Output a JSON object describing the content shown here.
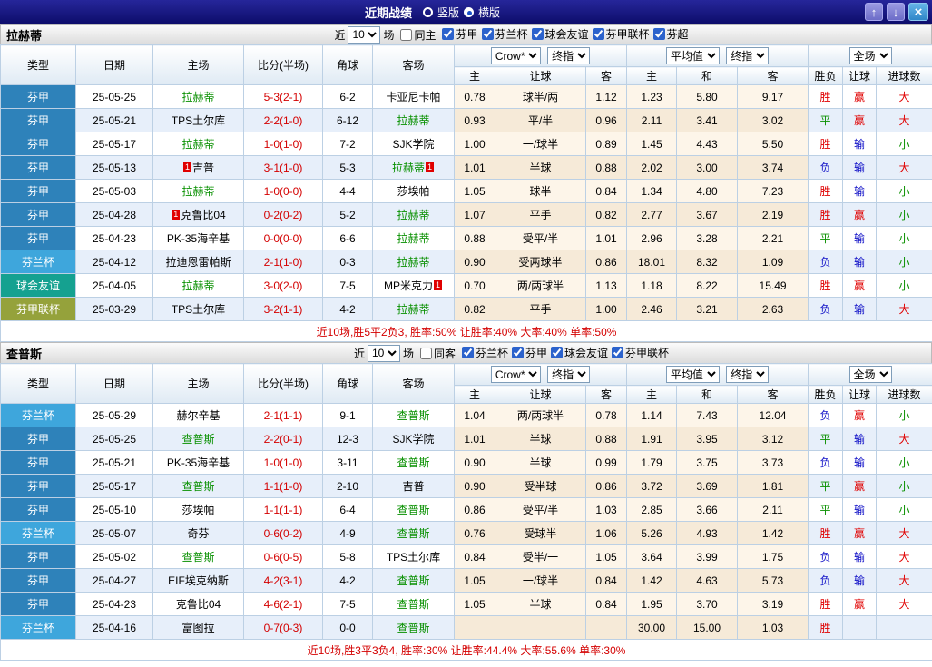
{
  "titlebar": {
    "title": "近期战绩",
    "vertical_label": "竖版",
    "horizontal_label": "横版",
    "selected": "横版",
    "up_icon": "↑",
    "down_icon": "↓",
    "close_icon": "×"
  },
  "type_colors": {
    "芬甲": "#2e82ba",
    "芬兰杯": "#3ea6dc",
    "球会友谊": "#15a190",
    "芬甲联杯": "#95a23b"
  },
  "value_colors": {
    "胜": "#e00000",
    "负": "#1515c8",
    "平": "#0a9000",
    "赢": "#e00000",
    "输": "#1515c8",
    "大": "#e00000",
    "小": "#0a9000"
  },
  "table_header": {
    "type": "类型",
    "date": "日期",
    "home": "主场",
    "score": "比分(半场)",
    "corner": "角球",
    "away": "客场",
    "odds_source": "Crow*",
    "odds_period": "终指",
    "avg_source": "平均值",
    "avg_period": "终指",
    "scope": "全场",
    "h": "主",
    "handicap": "让球",
    "a": "客",
    "avg_h": "主",
    "avg_d": "和",
    "avg_a": "客",
    "result": "胜负",
    "handicap_result": "让球",
    "goals": "进球数"
  },
  "sections": [
    {
      "team": "拉赫蒂",
      "filters": {
        "recent_label": "近",
        "recent_value": "10",
        "games_label": "场",
        "same_label": "同主",
        "same_checked": false,
        "leagues": [
          {
            "label": "芬甲",
            "checked": true
          },
          {
            "label": "芬兰杯",
            "checked": true
          },
          {
            "label": "球会友谊",
            "checked": true
          },
          {
            "label": "芬甲联杯",
            "checked": true
          },
          {
            "label": "芬超",
            "checked": true
          }
        ]
      },
      "rows": [
        {
          "type": "芬甲",
          "date": "25-05-25",
          "home": "拉赫蒂",
          "home_card": "",
          "home_focus": true,
          "score": "5-3(2-1)",
          "corners": "6-2",
          "away": "卡亚尼卡帕",
          "away_card": "",
          "away_focus": false,
          "odds_home": "0.78",
          "handicap": "球半/两",
          "odds_away": "1.12",
          "avg_home": "1.23",
          "avg_draw": "5.80",
          "avg_away": "9.17",
          "result": "胜",
          "handicap_result": "赢",
          "goals": "大"
        },
        {
          "type": "芬甲",
          "date": "25-05-21",
          "home": "TPS土尔库",
          "home_card": "",
          "home_focus": false,
          "score": "2-2(1-0)",
          "corners": "6-12",
          "away": "拉赫蒂",
          "away_card": "",
          "away_focus": true,
          "odds_home": "0.93",
          "handicap": "平/半",
          "odds_away": "0.96",
          "avg_home": "2.11",
          "avg_draw": "3.41",
          "avg_away": "3.02",
          "result": "平",
          "handicap_result": "赢",
          "goals": "大"
        },
        {
          "type": "芬甲",
          "date": "25-05-17",
          "home": "拉赫蒂",
          "home_card": "",
          "home_focus": true,
          "score": "1-0(1-0)",
          "corners": "7-2",
          "away": "SJK学院",
          "away_card": "",
          "away_focus": false,
          "odds_home": "1.00",
          "handicap": "一/球半",
          "odds_away": "0.89",
          "avg_home": "1.45",
          "avg_draw": "4.43",
          "avg_away": "5.50",
          "result": "胜",
          "handicap_result": "输",
          "goals": "小"
        },
        {
          "type": "芬甲",
          "date": "25-05-13",
          "home": "吉普",
          "home_card": "1",
          "home_focus": false,
          "score": "3-1(1-0)",
          "corners": "5-3",
          "away": "拉赫蒂",
          "away_card": "1",
          "away_focus": true,
          "odds_home": "1.01",
          "handicap": "半球",
          "odds_away": "0.88",
          "avg_home": "2.02",
          "avg_draw": "3.00",
          "avg_away": "3.74",
          "result": "负",
          "handicap_result": "输",
          "goals": "大"
        },
        {
          "type": "芬甲",
          "date": "25-05-03",
          "home": "拉赫蒂",
          "home_card": "",
          "home_focus": true,
          "score": "1-0(0-0)",
          "corners": "4-4",
          "away": "莎埃帕",
          "away_card": "",
          "away_focus": false,
          "odds_home": "1.05",
          "handicap": "球半",
          "odds_away": "0.84",
          "avg_home": "1.34",
          "avg_draw": "4.80",
          "avg_away": "7.23",
          "result": "胜",
          "handicap_result": "输",
          "goals": "小"
        },
        {
          "type": "芬甲",
          "date": "25-04-28",
          "home": "克鲁比04",
          "home_card": "1",
          "home_focus": false,
          "score": "0-2(0-2)",
          "corners": "5-2",
          "away": "拉赫蒂",
          "away_card": "",
          "away_focus": true,
          "odds_home": "1.07",
          "handicap": "平手",
          "odds_away": "0.82",
          "avg_home": "2.77",
          "avg_draw": "3.67",
          "avg_away": "2.19",
          "result": "胜",
          "handicap_result": "赢",
          "goals": "小"
        },
        {
          "type": "芬甲",
          "date": "25-04-23",
          "home": "PK-35海辛基",
          "home_card": "",
          "home_focus": false,
          "score": "0-0(0-0)",
          "corners": "6-6",
          "away": "拉赫蒂",
          "away_card": "",
          "away_focus": true,
          "odds_home": "0.88",
          "handicap": "受平/半",
          "odds_away": "1.01",
          "avg_home": "2.96",
          "avg_draw": "3.28",
          "avg_away": "2.21",
          "result": "平",
          "handicap_result": "输",
          "goals": "小"
        },
        {
          "type": "芬兰杯",
          "date": "25-04-12",
          "home": "拉迪恩雷帕斯",
          "home_card": "",
          "home_focus": false,
          "score": "2-1(1-0)",
          "corners": "0-3",
          "away": "拉赫蒂",
          "away_card": "",
          "away_focus": true,
          "odds_home": "0.90",
          "handicap": "受两球半",
          "odds_away": "0.86",
          "avg_home": "18.01",
          "avg_draw": "8.32",
          "avg_away": "1.09",
          "result": "负",
          "handicap_result": "输",
          "goals": "小"
        },
        {
          "type": "球会友谊",
          "date": "25-04-05",
          "home": "拉赫蒂",
          "home_card": "",
          "home_focus": true,
          "score": "3-0(2-0)",
          "corners": "7-5",
          "away": "MP米克力",
          "away_card": "1",
          "away_focus": false,
          "odds_home": "0.70",
          "handicap": "两/两球半",
          "odds_away": "1.13",
          "avg_home": "1.18",
          "avg_draw": "8.22",
          "avg_away": "15.49",
          "result": "胜",
          "handicap_result": "赢",
          "goals": "小"
        },
        {
          "type": "芬甲联杯",
          "date": "25-03-29",
          "home": "TPS土尔库",
          "home_card": "",
          "home_focus": false,
          "score": "3-2(1-1)",
          "corners": "4-2",
          "away": "拉赫蒂",
          "away_card": "",
          "away_focus": true,
          "odds_home": "0.82",
          "handicap": "平手",
          "odds_away": "1.00",
          "avg_home": "2.46",
          "avg_draw": "3.21",
          "avg_away": "2.63",
          "result": "负",
          "handicap_result": "输",
          "goals": "大"
        }
      ],
      "summary": "近10场,胜5平2负3, 胜率:50% 让胜率:40% 大率:40% 单率:50%"
    },
    {
      "team": "查普斯",
      "filters": {
        "recent_label": "近",
        "recent_value": "10",
        "games_label": "场",
        "same_label": "同客",
        "same_checked": false,
        "leagues": [
          {
            "label": "芬兰杯",
            "checked": true
          },
          {
            "label": "芬甲",
            "checked": true
          },
          {
            "label": "球会友谊",
            "checked": true
          },
          {
            "label": "芬甲联杯",
            "checked": true
          }
        ]
      },
      "rows": [
        {
          "type": "芬兰杯",
          "date": "25-05-29",
          "home": "赫尔辛基",
          "home_card": "",
          "home_focus": false,
          "score": "2-1(1-1)",
          "corners": "9-1",
          "away": "查普斯",
          "away_card": "",
          "away_focus": true,
          "odds_home": "1.04",
          "handicap": "两/两球半",
          "odds_away": "0.78",
          "avg_home": "1.14",
          "avg_draw": "7.43",
          "avg_away": "12.04",
          "result": "负",
          "handicap_result": "赢",
          "goals": "小"
        },
        {
          "type": "芬甲",
          "date": "25-05-25",
          "home": "查普斯",
          "home_card": "",
          "home_focus": true,
          "score": "2-2(0-1)",
          "corners": "12-3",
          "away": "SJK学院",
          "away_card": "",
          "away_focus": false,
          "odds_home": "1.01",
          "handicap": "半球",
          "odds_away": "0.88",
          "avg_home": "1.91",
          "avg_draw": "3.95",
          "avg_away": "3.12",
          "result": "平",
          "handicap_result": "输",
          "goals": "大"
        },
        {
          "type": "芬甲",
          "date": "25-05-21",
          "home": "PK-35海辛基",
          "home_card": "",
          "home_focus": false,
          "score": "1-0(1-0)",
          "corners": "3-11",
          "away": "查普斯",
          "away_card": "",
          "away_focus": true,
          "odds_home": "0.90",
          "handicap": "半球",
          "odds_away": "0.99",
          "avg_home": "1.79",
          "avg_draw": "3.75",
          "avg_away": "3.73",
          "result": "负",
          "handicap_result": "输",
          "goals": "小"
        },
        {
          "type": "芬甲",
          "date": "25-05-17",
          "home": "查普斯",
          "home_card": "",
          "home_focus": true,
          "score": "1-1(1-0)",
          "corners": "2-10",
          "away": "吉普",
          "away_card": "",
          "away_focus": false,
          "odds_home": "0.90",
          "handicap": "受半球",
          "odds_away": "0.86",
          "avg_home": "3.72",
          "avg_draw": "3.69",
          "avg_away": "1.81",
          "result": "平",
          "handicap_result": "赢",
          "goals": "小"
        },
        {
          "type": "芬甲",
          "date": "25-05-10",
          "home": "莎埃帕",
          "home_card": "",
          "home_focus": false,
          "score": "1-1(1-1)",
          "corners": "6-4",
          "away": "查普斯",
          "away_card": "",
          "away_focus": true,
          "odds_home": "0.86",
          "handicap": "受平/半",
          "odds_away": "1.03",
          "avg_home": "2.85",
          "avg_draw": "3.66",
          "avg_away": "2.11",
          "result": "平",
          "handicap_result": "输",
          "goals": "小"
        },
        {
          "type": "芬兰杯",
          "date": "25-05-07",
          "home": "奇芬",
          "home_card": "",
          "home_focus": false,
          "score": "0-6(0-2)",
          "corners": "4-9",
          "away": "查普斯",
          "away_card": "",
          "away_focus": true,
          "odds_home": "0.76",
          "handicap": "受球半",
          "odds_away": "1.06",
          "avg_home": "5.26",
          "avg_draw": "4.93",
          "avg_away": "1.42",
          "result": "胜",
          "handicap_result": "赢",
          "goals": "大"
        },
        {
          "type": "芬甲",
          "date": "25-05-02",
          "home": "查普斯",
          "home_card": "",
          "home_focus": true,
          "score": "0-6(0-5)",
          "corners": "5-8",
          "away": "TPS土尔库",
          "away_card": "",
          "away_focus": false,
          "odds_home": "0.84",
          "handicap": "受半/一",
          "odds_away": "1.05",
          "avg_home": "3.64",
          "avg_draw": "3.99",
          "avg_away": "1.75",
          "result": "负",
          "handicap_result": "输",
          "goals": "大"
        },
        {
          "type": "芬甲",
          "date": "25-04-27",
          "home": "EIF埃克纳斯",
          "home_card": "",
          "home_focus": false,
          "score": "4-2(3-1)",
          "corners": "4-2",
          "away": "查普斯",
          "away_card": "",
          "away_focus": true,
          "odds_home": "1.05",
          "handicap": "一/球半",
          "odds_away": "0.84",
          "avg_home": "1.42",
          "avg_draw": "4.63",
          "avg_away": "5.73",
          "result": "负",
          "handicap_result": "输",
          "goals": "大"
        },
        {
          "type": "芬甲",
          "date": "25-04-23",
          "home": "克鲁比04",
          "home_card": "",
          "home_focus": false,
          "score": "4-6(2-1)",
          "corners": "7-5",
          "away": "查普斯",
          "away_card": "",
          "away_focus": true,
          "odds_home": "1.05",
          "handicap": "半球",
          "odds_away": "0.84",
          "avg_home": "1.95",
          "avg_draw": "3.70",
          "avg_away": "3.19",
          "result": "胜",
          "handicap_result": "赢",
          "goals": "大"
        },
        {
          "type": "芬兰杯",
          "date": "25-04-16",
          "home": "富图拉",
          "home_card": "",
          "home_focus": false,
          "score": "0-7(0-3)",
          "corners": "0-0",
          "away": "查普斯",
          "away_card": "",
          "away_focus": true,
          "odds_home": "",
          "handicap": "",
          "odds_away": "",
          "avg_home": "30.00",
          "avg_draw": "15.00",
          "avg_away": "1.03",
          "result": "胜",
          "handicap_result": "",
          "goals": ""
        }
      ],
      "summary": "近10场,胜3平3负4, 胜率:30% 让胜率:44.4% 大率:55.6% 单率:30%"
    }
  ]
}
